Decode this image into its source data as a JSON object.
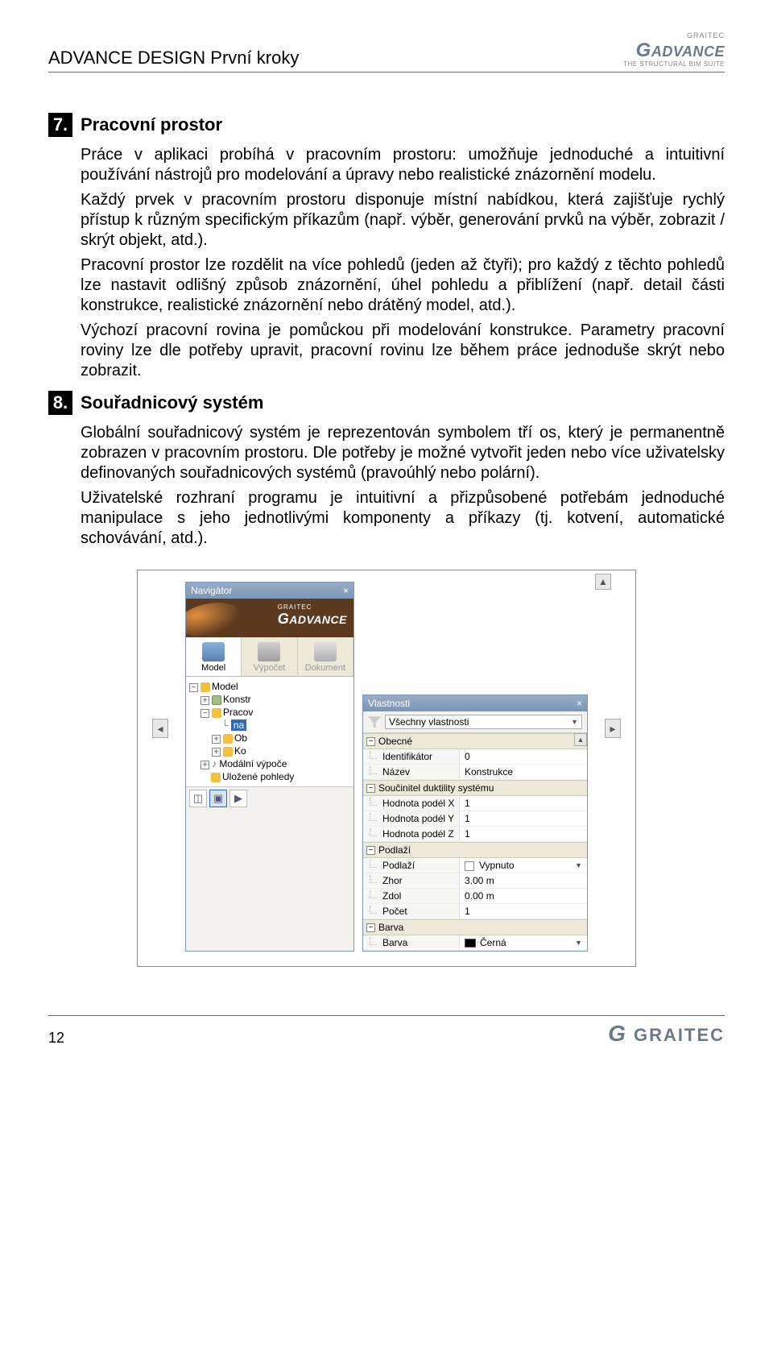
{
  "header": {
    "title": "ADVANCE DESIGN První kroky",
    "logo_small": "GRAITEC",
    "logo_brand": "ADVANCE",
    "logo_tag": "THE STRUCTURAL BIM SUITE"
  },
  "section7": {
    "num": "7.",
    "title": "Pracovní prostor",
    "p1": "Práce v aplikaci probíhá v pracovním prostoru: umožňuje jednoduché a intuitivní používání nástrojů pro modelování a úpravy nebo realistické znázornění modelu.",
    "p2": "Každý prvek v pracovním prostoru disponuje místní nabídkou, která zajišťuje rychlý přístup k různým specifickým příkazům (např. výběr, generování prvků na výběr, zobrazit / skrýt objekt, atd.).",
    "p3": "Pracovní prostor lze rozdělit na více pohledů (jeden až čtyři); pro každý z těchto pohledů lze nastavit odlišný způsob znázornění, úhel pohledu a přiblížení (např. detail části konstrukce, realistické znázornění nebo drátěný model, atd.).",
    "p4": "Výchozí pracovní rovina je pomůckou při modelování konstrukce. Parametry pracovní roviny lze dle potřeby upravit, pracovní rovinu lze během práce jednoduše skrýt nebo zobrazit."
  },
  "section8": {
    "num": "8.",
    "title": "Souřadnicový systém",
    "p1": "Globální souřadnicový systém je reprezentován symbolem tří os, který je permanentně zobrazen v pracovním prostoru. Dle potřeby je možné vytvořit jeden nebo více uživatelsky definovaných souřadnicových systémů (pravoúhlý nebo polární).",
    "p2": "Uživatelské rozhraní programu je intuitivní a přizpůsobené potřebám jednoduché manipulace s jeho jednotlivými komponenty a příkazy (tj. kotvení, automatické schovávání, atd.)."
  },
  "navigator": {
    "title": "Navigátor",
    "logo_small": "GRAITEC",
    "logo_brand": "ADVANCE",
    "tabs": {
      "model": "Model",
      "calc": "Výpočet",
      "doc": "Dokument"
    },
    "tree": {
      "root": "Model",
      "konstr": "Konstr",
      "pracov": "Pracov",
      "pracov_sel": "na",
      "ob": "Ob",
      "ko": "Ko",
      "modalni": "Modální výpoče",
      "ulozene": "Uložené pohledy"
    }
  },
  "properties": {
    "title": "Vlastnosti",
    "filter": "Všechny vlastnosti",
    "sections": {
      "obecne": "Obecné",
      "soucinitel": "Součinitel duktility systému",
      "podlazi": "Podlaží",
      "barva": "Barva"
    },
    "rows": {
      "identifikator": {
        "k": "Identifikátor",
        "v": "0"
      },
      "nazev": {
        "k": "Název",
        "v": "Konstrukce"
      },
      "hodnotax": {
        "k": "Hodnota podél X",
        "v": "1"
      },
      "hodnotay": {
        "k": "Hodnota podél Y",
        "v": "1"
      },
      "hodnotaz": {
        "k": "Hodnota podél Z",
        "v": "1"
      },
      "podlazi": {
        "k": "Podlaží",
        "v": "Vypnuto"
      },
      "zhor": {
        "k": "Zhor",
        "v": "3.00 m"
      },
      "zdol": {
        "k": "Zdol",
        "v": "0.00 m"
      },
      "pocet": {
        "k": "Počet",
        "v": "1"
      },
      "barva": {
        "k": "Barva",
        "v": "Černá"
      }
    }
  },
  "footer": {
    "page": "12",
    "brand": "GRAITEC"
  }
}
